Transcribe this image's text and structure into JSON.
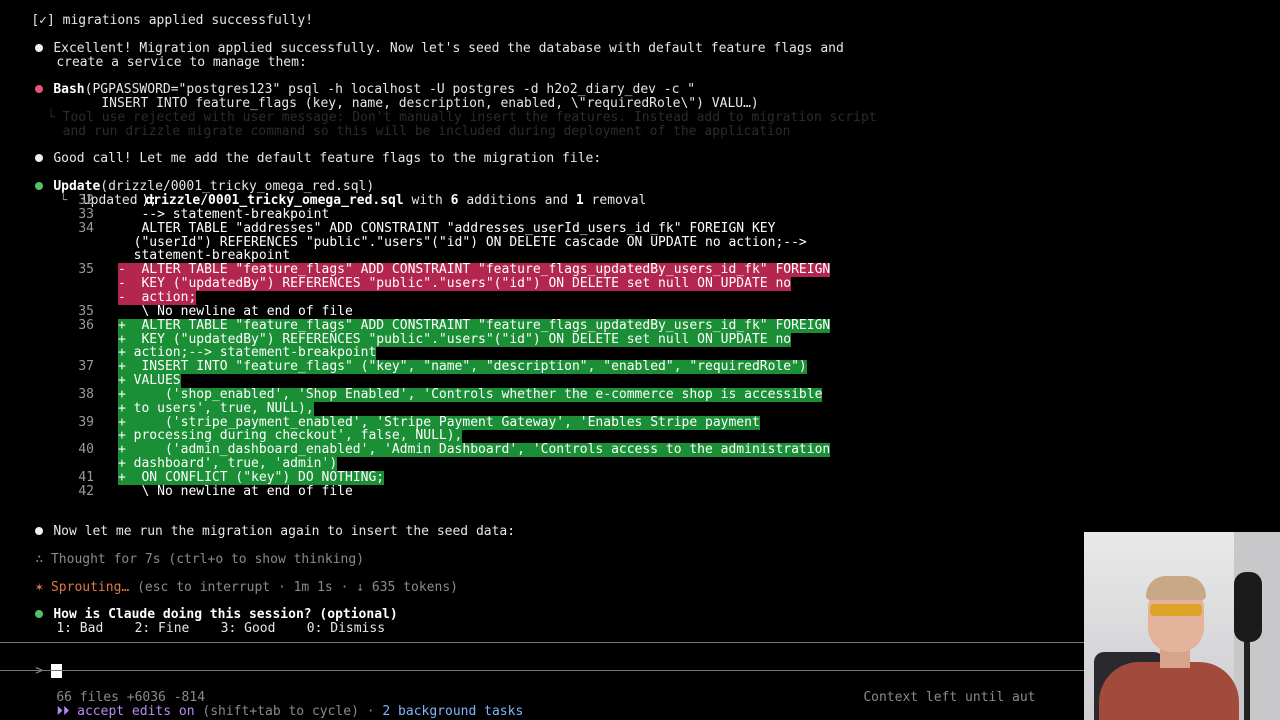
{
  "lines": {
    "l1": "[✓] migrations applied successfully!",
    "l2a": "Excellent! Migration applied successfully. Now let's seed the database with default feature flags and",
    "l2b": "create a service to manage them:",
    "bash_label": "Bash",
    "bash_cmd1": "(PGPASSWORD=\"postgres123\" psql -h localhost -U postgres -d h2o2_diary_dev -c \"",
    "bash_cmd2": "INSERT INTO feature_flags (key, name, description, enabled, \\\"requiredRole\\\") VALU…)",
    "rejected1": "  └ Tool use rejected with user message: Don't manually insert the features. Instead add to migration script",
    "rejected2": "    and run drizzle migrate command so this will be included during deployment of the application",
    "good_call": "Good call! Let me add the default feature flags to the migration file:",
    "update_label": "Update",
    "update_args": "(drizzle/0001_tricky_omega_red.sql)",
    "updated_prefix": "Updated ",
    "updated_file": "drizzle/0001_tricky_omega_red.sql",
    "updated_mid": " with ",
    "updated_adds": "6",
    "updated_mid2": " additions and ",
    "updated_rem": "1",
    "updated_end": " removal",
    "now_run": "Now let me run the migration again to insert the seed data:",
    "thought": "Thought for 7s (ctrl+o to show thinking)",
    "sprouting": "Sprouting…",
    "sprouting_rest": " (esc to interrupt · 1m 1s · ↓ 635 tokens)",
    "survey_q": "How is Claude doing this session? (optional)",
    "survey_opts": "1: Bad    2: Fine    3: Good    0: Dismiss",
    "files_stat": "66 files +6036 -814",
    "accept_edits": "⏵⏵ accept edits on",
    "accept_rest": " (shift+tab to cycle) · ",
    "bg_tasks": "2 background tasks",
    "context_left": "Context left until aut"
  },
  "diff": [
    {
      "n": "32",
      "t": "normal",
      "text": "   );"
    },
    {
      "n": "33",
      "t": "normal",
      "text": "   --> statement-breakpoint"
    },
    {
      "n": "34",
      "t": "normal",
      "text": "   ALTER TABLE \"addresses\" ADD CONSTRAINT \"addresses_userId_users_id_fk\" FOREIGN KEY"
    },
    {
      "n": "",
      "t": "normal",
      "text": "  (\"userId\") REFERENCES \"public\".\"users\"(\"id\") ON DELETE cascade ON UPDATE no action;-->"
    },
    {
      "n": "",
      "t": "normal",
      "text": "  statement-breakpoint"
    },
    {
      "n": "35",
      "t": "del",
      "text": "-  ALTER TABLE \"feature_flags\" ADD CONSTRAINT \"feature_flags_updatedBy_users_id_fk\" FOREIGN"
    },
    {
      "n": "",
      "t": "del",
      "text": "-  KEY (\"updatedBy\") REFERENCES \"public\".\"users\"(\"id\") ON DELETE set null ON UPDATE no"
    },
    {
      "n": "",
      "t": "del",
      "text": "-  action;"
    },
    {
      "n": "35",
      "t": "normal",
      "text": "   \\ No newline at end of file"
    },
    {
      "n": "36",
      "t": "add",
      "text": "+  ALTER TABLE \"feature_flags\" ADD CONSTRAINT \"feature_flags_updatedBy_users_id_fk\" FOREIGN"
    },
    {
      "n": "",
      "t": "add",
      "text": "+  KEY (\"updatedBy\") REFERENCES \"public\".\"users\"(\"id\") ON DELETE set null ON UPDATE no"
    },
    {
      "n": "",
      "t": "add",
      "text": "+ action;--> statement-breakpoint"
    },
    {
      "n": "37",
      "t": "add",
      "text": "+  INSERT INTO \"feature_flags\" (\"key\", \"name\", \"description\", \"enabled\", \"requiredRole\")"
    },
    {
      "n": "",
      "t": "add",
      "text": "+ VALUES"
    },
    {
      "n": "38",
      "t": "add",
      "text": "+     ('shop_enabled', 'Shop Enabled', 'Controls whether the e-commerce shop is accessible"
    },
    {
      "n": "",
      "t": "add",
      "text": "+ to users', true, NULL),"
    },
    {
      "n": "39",
      "t": "add",
      "text": "+     ('stripe_payment_enabled', 'Stripe Payment Gateway', 'Enables Stripe payment"
    },
    {
      "n": "",
      "t": "add",
      "text": "+ processing during checkout', false, NULL),"
    },
    {
      "n": "40",
      "t": "add",
      "text": "+     ('admin_dashboard_enabled', 'Admin Dashboard', 'Controls access to the administration"
    },
    {
      "n": "",
      "t": "add",
      "text": "+ dashboard', true, 'admin')"
    },
    {
      "n": "41",
      "t": "add",
      "text": "+  ON CONFLICT (\"key\") DO NOTHING;"
    },
    {
      "n": "42",
      "t": "normal",
      "text": "   \\ No newline at end of file"
    }
  ],
  "colors": {
    "del": "#b3264f",
    "add": "#1a8f35",
    "accent": "#e07a4a",
    "bullet_pink": "#e8557a",
    "bullet_green": "#4ec36a"
  }
}
